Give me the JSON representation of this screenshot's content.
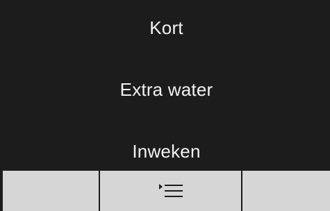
{
  "menu": {
    "items": [
      {
        "label": "Kort"
      },
      {
        "label": "Extra water"
      },
      {
        "label": "Inweken"
      }
    ]
  },
  "bottom_bar": {
    "buttons": [
      {
        "name": "left-softkey",
        "icon": null
      },
      {
        "name": "menu-list-softkey",
        "icon": "menu-list-icon"
      },
      {
        "name": "right-softkey",
        "icon": null
      }
    ]
  },
  "colors": {
    "background": "#1c1c1c",
    "text": "#f2f2f2",
    "softkey_bar": "#d6d6d6"
  }
}
